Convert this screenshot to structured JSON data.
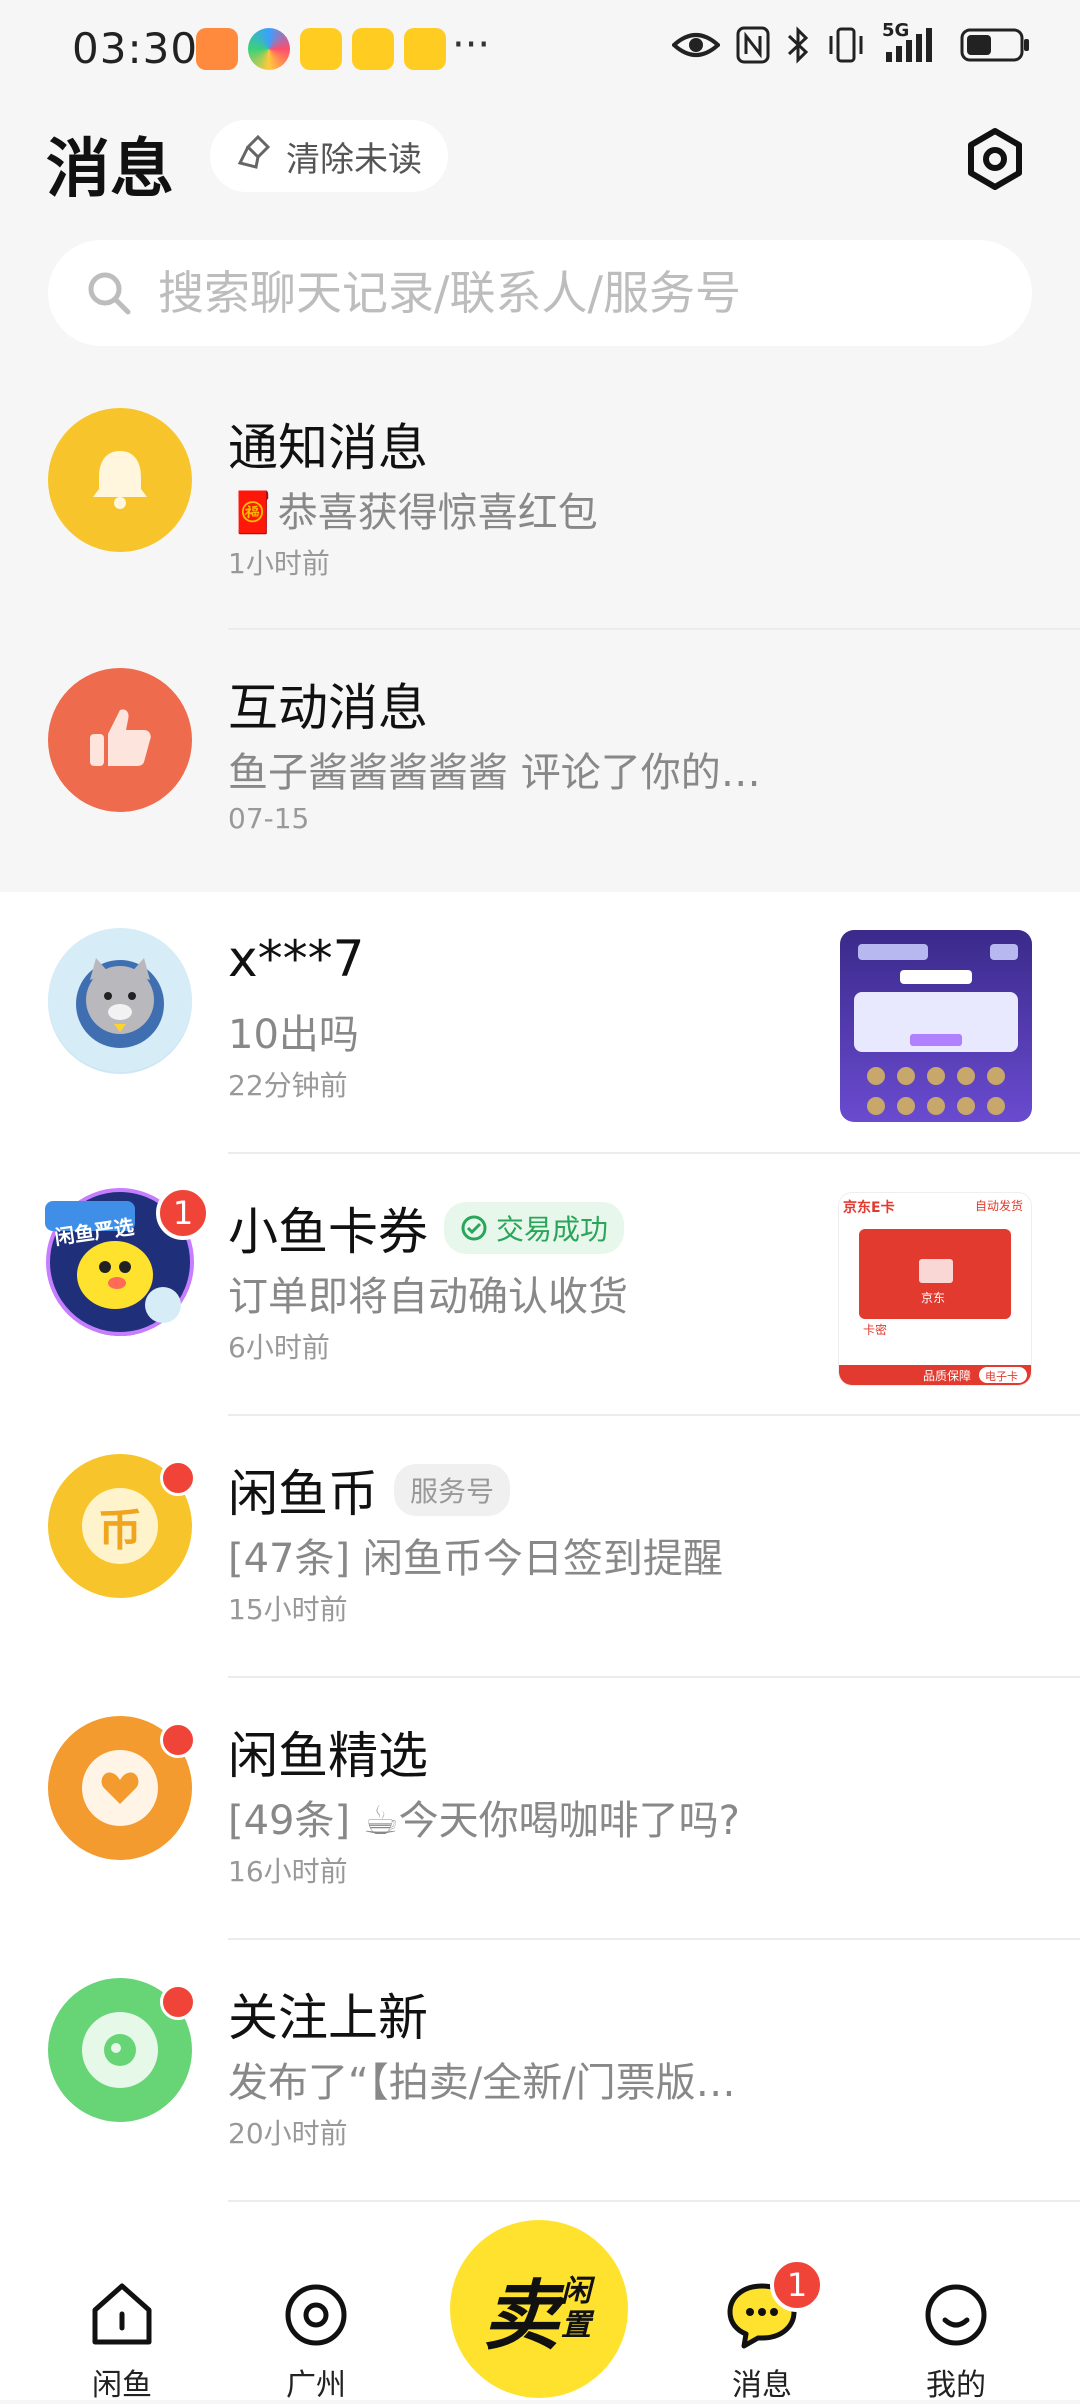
{
  "status_bar": {
    "time": "03:30",
    "dots": "···",
    "network": "5G",
    "icons": [
      "eye-icon",
      "nfc-icon",
      "bluetooth-icon",
      "vibrate-icon",
      "signal-icon",
      "battery-icon"
    ]
  },
  "header": {
    "title": "消息",
    "clear_unread": "清除未读",
    "settings_icon": "settings-icon"
  },
  "search": {
    "placeholder": "搜索聊天记录/联系人/服务号"
  },
  "pinned": [
    {
      "name": "通知消息",
      "preview": "🧧恭喜获得惊喜红包",
      "time": "1小时前",
      "avatar_color": "#f7c52b",
      "icon": "bell-icon"
    },
    {
      "name": "互动消息",
      "preview": "鱼子酱酱酱酱酱 评论了你的…",
      "time": "07-15",
      "avatar_color": "#ee6c4d",
      "icon": "thumbs-up-icon"
    }
  ],
  "conversations": [
    {
      "name": "x***7",
      "preview": "10出吗",
      "time": "22分钟前",
      "thumbnail": "game-screenshot"
    },
    {
      "name": "小鱼卡券",
      "tag": "交易成功",
      "preview": "订单即将自动确认收货",
      "time": "6小时前",
      "badge": "1",
      "avatar_label": "闲鱼严选",
      "thumb_texts": {
        "card": "京东E卡",
        "auto": "自动发货",
        "jd": "京东",
        "kami": "卡密",
        "guarantee": "品质保障",
        "ecard": "电子卡"
      }
    },
    {
      "name": "闲鱼币",
      "tag": "服务号",
      "preview": "[47条] 闲鱼币今日签到提醒",
      "time": "15小时前",
      "avatar_char": "币",
      "avatar_color": "#f7c52b"
    },
    {
      "name": "闲鱼精选",
      "preview": "[49条] ☕今天你喝咖啡了吗?",
      "time": "16小时前",
      "avatar_color": "#f39b2e"
    },
    {
      "name": "关注上新",
      "preview": "发布了“【拍卖/全新/门票版…",
      "time": "20小时前",
      "avatar_color": "#67d476"
    }
  ],
  "tabbar": {
    "home": "闲鱼",
    "city": "广州",
    "sell_main": "卖",
    "sell_sub": "闲置",
    "messages": "消息",
    "messages_badge": "1",
    "mine": "我的"
  },
  "colors": {
    "accent_yellow": "#ffe22e",
    "badge_red": "#f04438",
    "tag_green": "#2aa65a"
  }
}
